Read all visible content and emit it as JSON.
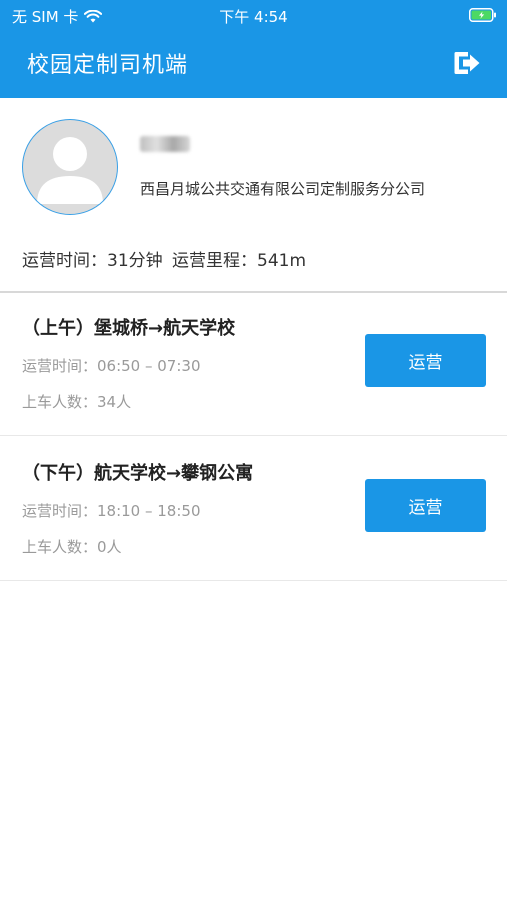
{
  "status_bar": {
    "carrier": "无 SIM 卡",
    "time": "下午 4:54"
  },
  "header": {
    "title": "校园定制司机端",
    "logout_icon": "logout-icon"
  },
  "profile": {
    "company": "西昌月城公共交通有限公司定制服务分公司",
    "op_time_label": "运营时间：31分钟",
    "op_distance_label": "运营里程：541m"
  },
  "trips": [
    {
      "title": "（上午）堡城桥→航天学校",
      "time": "运营时间：06:50 – 07:30",
      "riders": "上车人数：34人",
      "button": "运营"
    },
    {
      "title": "（下午）航天学校→攀钢公寓",
      "time": "运营时间：18:10 – 18:50",
      "riders": "上车人数：0人",
      "button": "运营"
    }
  ],
  "colors": {
    "primary": "#1a96e6",
    "battery": "#4cd964"
  }
}
